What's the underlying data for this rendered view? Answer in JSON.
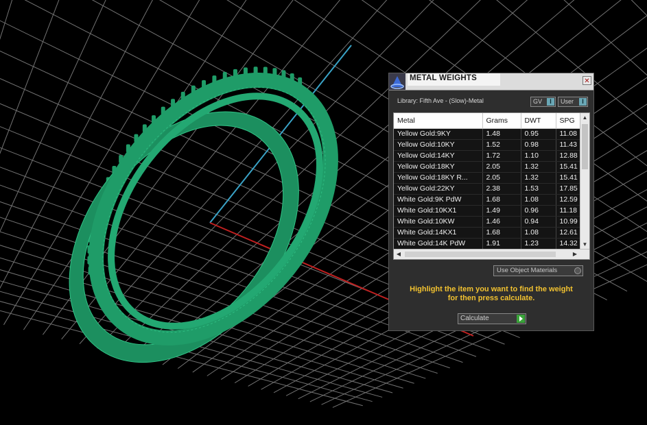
{
  "panel": {
    "title": "METAL WEIGHTS",
    "close_label": "✕",
    "library_label": "Library: Fifth Ave - (Slow)-Metal",
    "toggle_gv": "GV",
    "toggle_user": "User",
    "toggle_indicator": "I",
    "table": {
      "columns": [
        "Metal",
        "Grams",
        "DWT",
        "SPG"
      ],
      "rows": [
        [
          "Yellow Gold:9KY",
          "1.48",
          "0.95",
          "11.08"
        ],
        [
          "Yellow Gold:10KY",
          "1.52",
          "0.98",
          "11.43"
        ],
        [
          "Yellow Gold:14KY",
          "1.72",
          "1.10",
          "12.88"
        ],
        [
          "Yellow Gold:18KY",
          "2.05",
          "1.32",
          "15.41"
        ],
        [
          "Yellow Gold:18KY R...",
          "2.05",
          "1.32",
          "15.41"
        ],
        [
          "Yellow Gold:22KY",
          "2.38",
          "1.53",
          "17.85"
        ],
        [
          "White Gold:9K PdW",
          "1.68",
          "1.08",
          "12.59"
        ],
        [
          "White Gold:10KX1",
          "1.49",
          "0.96",
          "11.18"
        ],
        [
          "White Gold:10KW",
          "1.46",
          "0.94",
          "10.99"
        ],
        [
          "White Gold:14KX1",
          "1.68",
          "1.08",
          "12.61"
        ],
        [
          "White Gold:14K PdW",
          "1.91",
          "1.23",
          "14.32"
        ]
      ]
    },
    "use_object_materials": "Use Object Materials",
    "hint_line1": "Highlight the item you want to find the weight",
    "hint_line2": "for then press calculate.",
    "calculate_label": "Calculate"
  },
  "colors": {
    "ring": "#1f9c68",
    "grid": "#9a9a9a",
    "axis_blue": "#3aa3c7",
    "axis_red": "#c02020",
    "hint": "#f2c230"
  }
}
